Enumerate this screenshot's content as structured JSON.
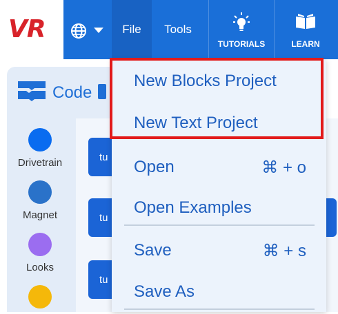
{
  "header": {
    "logo": "VR",
    "language_icon": "globe-icon",
    "file_label": "File",
    "tools_label": "Tools",
    "tutorials_label": "TUTORIALS",
    "learn_label": "LEARN"
  },
  "sidebar": {
    "code_tab_label": "Code",
    "categories": [
      {
        "label": "Drivetrain",
        "color": "#0a6cf0"
      },
      {
        "label": "Magnet",
        "color": "#2a72c9"
      },
      {
        "label": "Looks",
        "color": "#9b6df0"
      },
      {
        "label": "",
        "color": "#f5b80a"
      }
    ]
  },
  "workspace": {
    "block_fragment": "tu"
  },
  "file_menu": {
    "items": [
      {
        "label": "New Blocks Project",
        "shortcut": ""
      },
      {
        "label": "New Text Project",
        "shortcut": ""
      },
      {
        "label": "Open",
        "shortcut": "⌘ + o"
      },
      {
        "label": "Open Examples",
        "shortcut": ""
      },
      {
        "label": "Save",
        "shortcut": "⌘ + s"
      },
      {
        "label": "Save As",
        "shortcut": ""
      }
    ]
  },
  "colors": {
    "menubar": "#1a6fd8",
    "logo_red": "#d8232a",
    "menu_text": "#1f5fbf",
    "highlight": "#e21b1b"
  }
}
